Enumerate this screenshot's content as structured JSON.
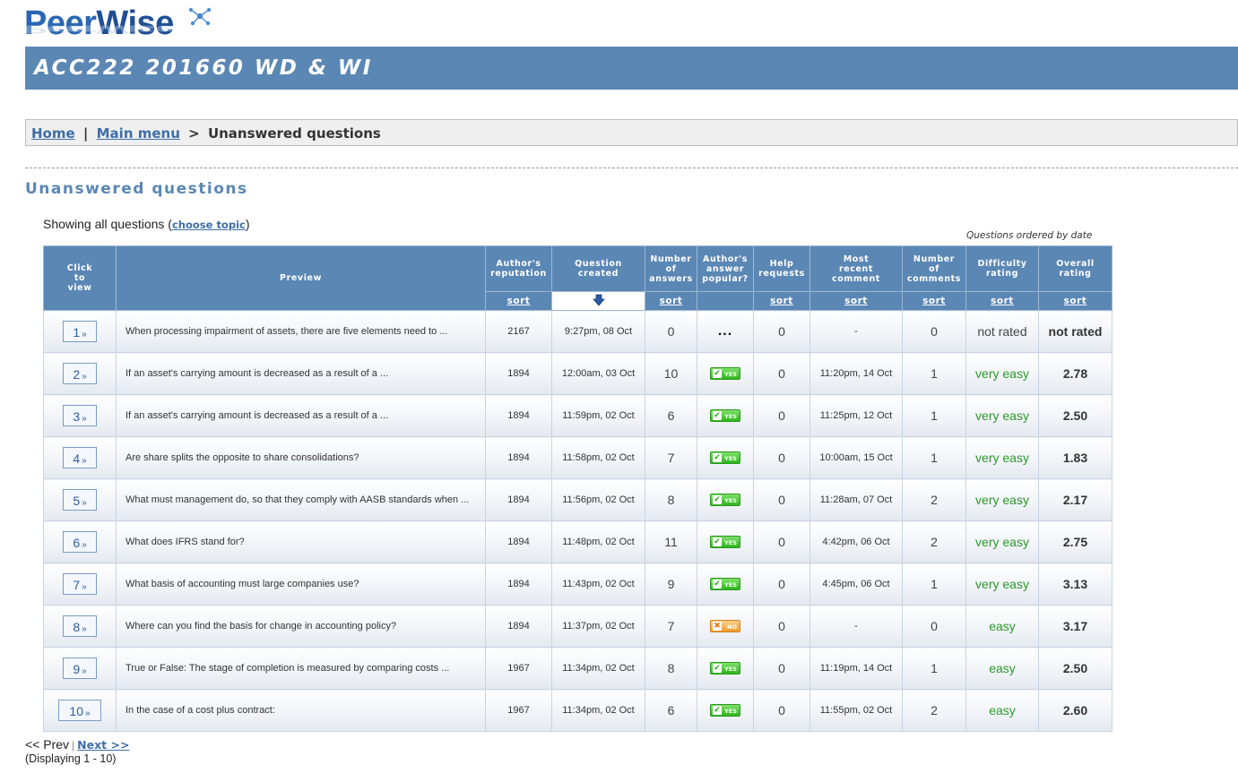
{
  "logo": {
    "text_peer": "Peer",
    "text_wise": "Wise"
  },
  "course": {
    "title": "ACC222 201660 WD & WI"
  },
  "breadcrumb": {
    "home": "Home",
    "sep1": "|",
    "main_menu": "Main menu",
    "sep2": ">",
    "current": "Unanswered questions"
  },
  "page": {
    "title": "Unanswered questions",
    "showing_prefix": "Showing all questions (",
    "choose_topic": "choose topic",
    "showing_suffix": ")",
    "ordered_by": "Questions ordered by date"
  },
  "table": {
    "headers": {
      "click_to_view": [
        "Click",
        "to",
        "view"
      ],
      "preview": "Preview",
      "author_reputation": [
        "Author's",
        "reputation"
      ],
      "question_created": [
        "Question",
        "created"
      ],
      "number_of_answers": [
        "Number",
        "of",
        "answers"
      ],
      "author_answer_popular": [
        "Author's",
        "answer",
        "popular?"
      ],
      "help_requests": [
        "Help",
        "requests"
      ],
      "most_recent_comment": [
        "Most",
        "recent",
        "comment"
      ],
      "number_of_comments": [
        "Number",
        "of",
        "comments"
      ],
      "difficulty_rating": [
        "Difficulty",
        "rating"
      ],
      "overall_rating": [
        "Overall",
        "rating"
      ]
    },
    "sort_label": "sort",
    "rows": [
      {
        "num": "1",
        "preview": "When processing impairment of assets, there are five elements need to ...",
        "rep": "2167",
        "created": "9:27pm, 08 Oct",
        "answers": "0",
        "popular": "pending",
        "popular_text": "...",
        "help": "0",
        "recent": "-",
        "comments": "0",
        "difficulty": "not rated",
        "overall": "not rated"
      },
      {
        "num": "2",
        "preview": "If an asset's carrying amount is decreased as a result of a ...",
        "rep": "1894",
        "created": "12:00am, 03 Oct",
        "answers": "10",
        "popular": "yes",
        "popular_text": "YES",
        "help": "0",
        "recent": "11:20pm, 14 Oct",
        "comments": "1",
        "difficulty": "very easy",
        "overall": "2.78"
      },
      {
        "num": "3",
        "preview": "If an asset's carrying amount is decreased as a result of a ...",
        "rep": "1894",
        "created": "11:59pm, 02 Oct",
        "answers": "6",
        "popular": "yes",
        "popular_text": "YES",
        "help": "0",
        "recent": "11:25pm, 12 Oct",
        "comments": "1",
        "difficulty": "very easy",
        "overall": "2.50"
      },
      {
        "num": "4",
        "preview": "Are share splits the opposite to share consolidations?",
        "rep": "1894",
        "created": "11:58pm, 02 Oct",
        "answers": "7",
        "popular": "yes",
        "popular_text": "YES",
        "help": "0",
        "recent": "10:00am, 15 Oct",
        "comments": "1",
        "difficulty": "very easy",
        "overall": "1.83"
      },
      {
        "num": "5",
        "preview": "What must management do, so that they comply with AASB standards when ...",
        "rep": "1894",
        "created": "11:56pm, 02 Oct",
        "answers": "8",
        "popular": "yes",
        "popular_text": "YES",
        "help": "0",
        "recent": "11:28am, 07 Oct",
        "comments": "2",
        "difficulty": "very easy",
        "overall": "2.17"
      },
      {
        "num": "6",
        "preview": "What does IFRS stand for?",
        "rep": "1894",
        "created": "11:48pm, 02 Oct",
        "answers": "11",
        "popular": "yes",
        "popular_text": "YES",
        "help": "0",
        "recent": "4:42pm, 06 Oct",
        "comments": "2",
        "difficulty": "very easy",
        "overall": "2.75"
      },
      {
        "num": "7",
        "preview": "What basis of accounting must large companies use?",
        "rep": "1894",
        "created": "11:43pm, 02 Oct",
        "answers": "9",
        "popular": "yes",
        "popular_text": "YES",
        "help": "0",
        "recent": "4:45pm, 06 Oct",
        "comments": "1",
        "difficulty": "very easy",
        "overall": "3.13"
      },
      {
        "num": "8",
        "preview": "Where can you find the basis for change in accounting policy?",
        "rep": "1894",
        "created": "11:37pm, 02 Oct",
        "answers": "7",
        "popular": "no",
        "popular_text": "NO",
        "help": "0",
        "recent": "-",
        "comments": "0",
        "difficulty": "easy",
        "overall": "3.17"
      },
      {
        "num": "9",
        "preview": "True or False: The stage of completion is measured by comparing costs ...",
        "rep": "1967",
        "created": "11:34pm, 02 Oct",
        "answers": "8",
        "popular": "yes",
        "popular_text": "YES",
        "help": "0",
        "recent": "11:19pm, 14 Oct",
        "comments": "1",
        "difficulty": "easy",
        "overall": "2.50"
      },
      {
        "num": "10",
        "preview": "In the case of a cost plus contract:",
        "rep": "1967",
        "created": "11:34pm, 02 Oct",
        "answers": "6",
        "popular": "yes",
        "popular_text": "YES",
        "help": "0",
        "recent": "11:55pm, 02 Oct",
        "comments": "2",
        "difficulty": "easy",
        "overall": "2.60"
      }
    ]
  },
  "pager": {
    "prev": "<< Prev",
    "sep": "|",
    "next": "Next >>",
    "displaying": "(Displaying 1 - 10)"
  },
  "colors": {
    "accent": "#5b87b5",
    "link": "#3f6ea8",
    "easy": "#2b9a2b"
  }
}
